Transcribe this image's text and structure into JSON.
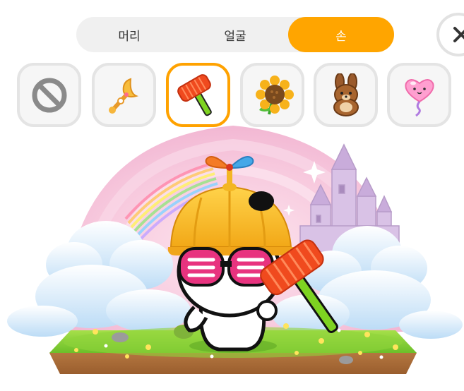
{
  "tabs": [
    {
      "label": "머리",
      "active": false
    },
    {
      "label": "얼굴",
      "active": false
    },
    {
      "label": "손",
      "active": true
    }
  ],
  "accent_color": "#ffa500",
  "items": [
    {
      "icon": "none-icon",
      "selected": false
    },
    {
      "icon": "moon-wand-icon",
      "selected": false
    },
    {
      "icon": "toy-hammer-icon",
      "selected": true
    },
    {
      "icon": "sunflower-icon",
      "selected": false
    },
    {
      "icon": "teddy-bunny-icon",
      "selected": false
    },
    {
      "icon": "heart-balloon-icon",
      "selected": false
    }
  ],
  "close_icon": "close-icon"
}
